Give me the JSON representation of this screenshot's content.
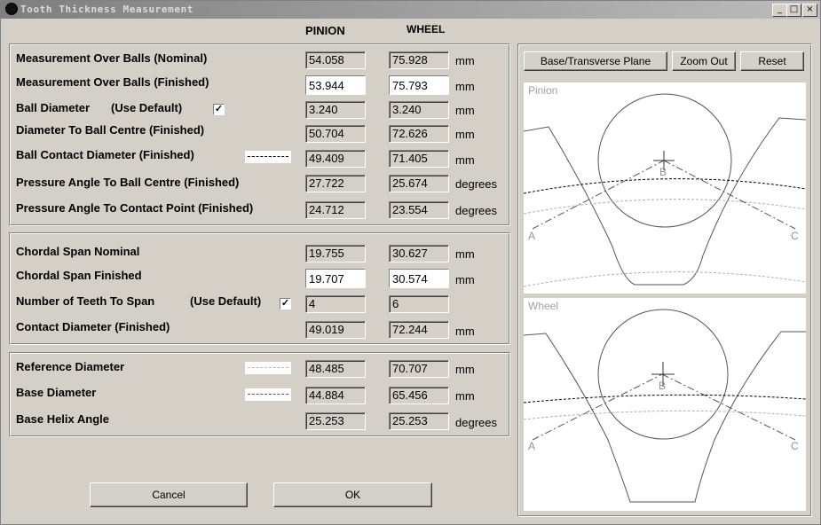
{
  "window": {
    "title": "Tooth Thickness Measurement",
    "controls": {
      "minimize": "_",
      "maximize": "□",
      "close": "×"
    }
  },
  "columns": {
    "pinion": "PINION",
    "wheel": "WHEEL"
  },
  "units": {
    "mm": "mm",
    "degrees": "degrees"
  },
  "balls": {
    "mob_nominal": {
      "label": "Measurement Over Balls (Nominal)",
      "pinion": "54.058",
      "wheel": "75.928"
    },
    "mob_finished": {
      "label": "Measurement Over Balls (Finished)",
      "pinion": "53.944",
      "wheel": "75.793"
    },
    "ball_diameter": {
      "label": "Ball Diameter",
      "use_default": "(Use Default)",
      "checked": true,
      "check_glyph": "✓",
      "pinion": "3.240",
      "wheel": "3.240"
    },
    "dia_ball_centre": {
      "label": "Diameter To Ball Centre (Finished)",
      "pinion": "50.704",
      "wheel": "72.626"
    },
    "ball_contact_dia": {
      "label": "Ball Contact Diameter (Finished)",
      "pinion": "49.409",
      "wheel": "71.405"
    },
    "pa_ball_centre": {
      "label": "Pressure Angle To Ball Centre (Finished)",
      "pinion": "27.722",
      "wheel": "25.674"
    },
    "pa_contact_point": {
      "label": "Pressure Angle To Contact Point (Finished)",
      "pinion": "24.712",
      "wheel": "23.554"
    }
  },
  "span": {
    "chordal_nominal": {
      "label": "Chordal Span Nominal",
      "pinion": "19.755",
      "wheel": "30.627"
    },
    "chordal_finished": {
      "label": "Chordal Span Finished",
      "pinion": "19.707",
      "wheel": "30.574"
    },
    "teeth_to_span": {
      "label": "Number of Teeth To Span",
      "use_default": "(Use Default)",
      "checked": true,
      "check_glyph": "✓",
      "pinion": "4",
      "wheel": "6"
    },
    "contact_diameter": {
      "label": "Contact Diameter (Finished)",
      "pinion": "49.019",
      "wheel": "72.244"
    }
  },
  "geometry": {
    "reference_diameter": {
      "label": "Reference Diameter",
      "pinion": "48.485",
      "wheel": "70.707"
    },
    "base_diameter": {
      "label": "Base Diameter",
      "pinion": "44.884",
      "wheel": "65.456"
    },
    "base_helix_angle": {
      "label": "Base Helix Angle",
      "pinion": "25.253",
      "wheel": "25.253"
    }
  },
  "buttons": {
    "cancel": "Cancel",
    "ok": "OK",
    "base_plane": "Base/Transverse Plane",
    "zoom_out": "Zoom Out",
    "reset": "Reset"
  },
  "views": {
    "pinion": {
      "title": "Pinion",
      "point_a": "A",
      "point_b": "B",
      "point_c": "C"
    },
    "wheel": {
      "title": "Wheel",
      "point_a": "A",
      "point_b": "B",
      "point_c": "C"
    }
  },
  "colors": {
    "face": "#d4d0c8",
    "title_start": "#7f7f7f",
    "title_end": "#bcbcbc",
    "drawing_line": "#555555",
    "drawing_light": "#b0b0b0"
  }
}
